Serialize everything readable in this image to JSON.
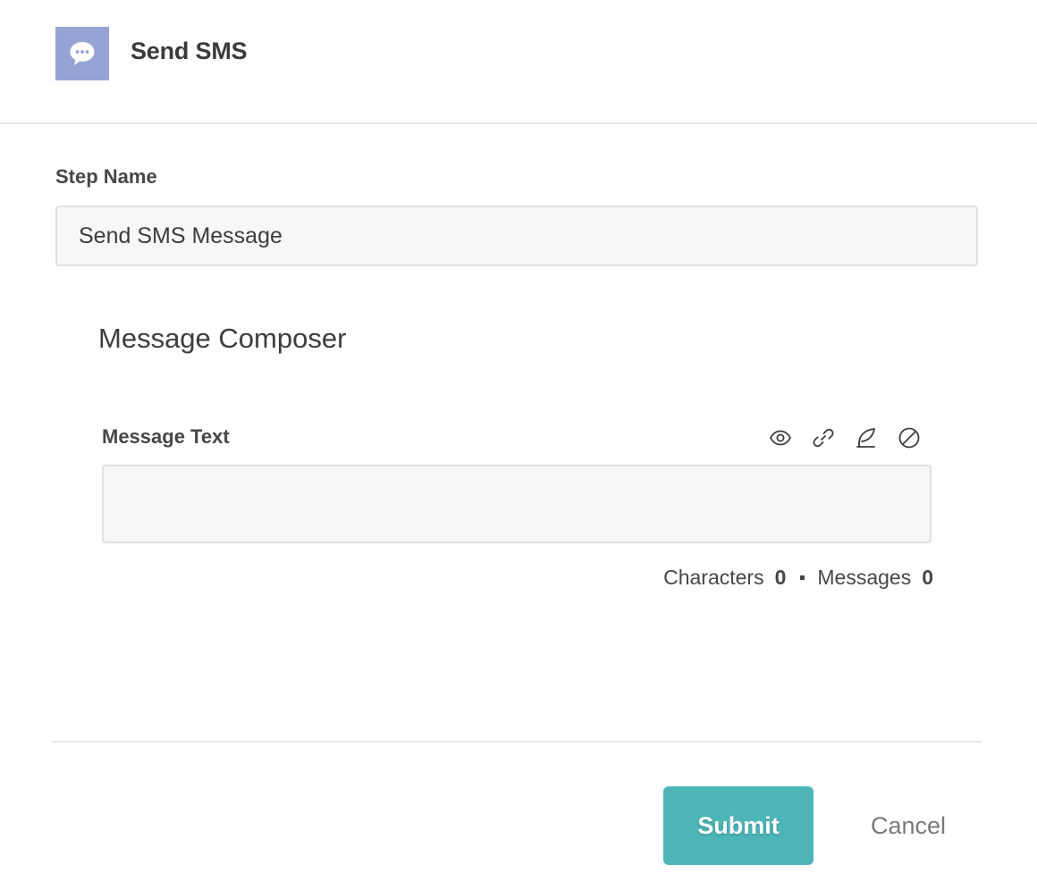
{
  "header": {
    "icon": "chat-bubble-icon",
    "icon_bg": "#97a3d4",
    "title": "Send SMS"
  },
  "step_name": {
    "label": "Step Name",
    "value": "Send SMS Message"
  },
  "composer": {
    "title": "Message Composer",
    "message_label": "Message Text",
    "message_value": "",
    "toolbar": [
      "eye-icon",
      "link-icon",
      "feather-icon",
      "block-icon"
    ],
    "counts": {
      "characters_label": "Characters",
      "characters": "0",
      "messages_label": "Messages",
      "messages": "0"
    }
  },
  "footer": {
    "submit_label": "Submit",
    "cancel_label": "Cancel",
    "accent": "#4db5b8"
  }
}
